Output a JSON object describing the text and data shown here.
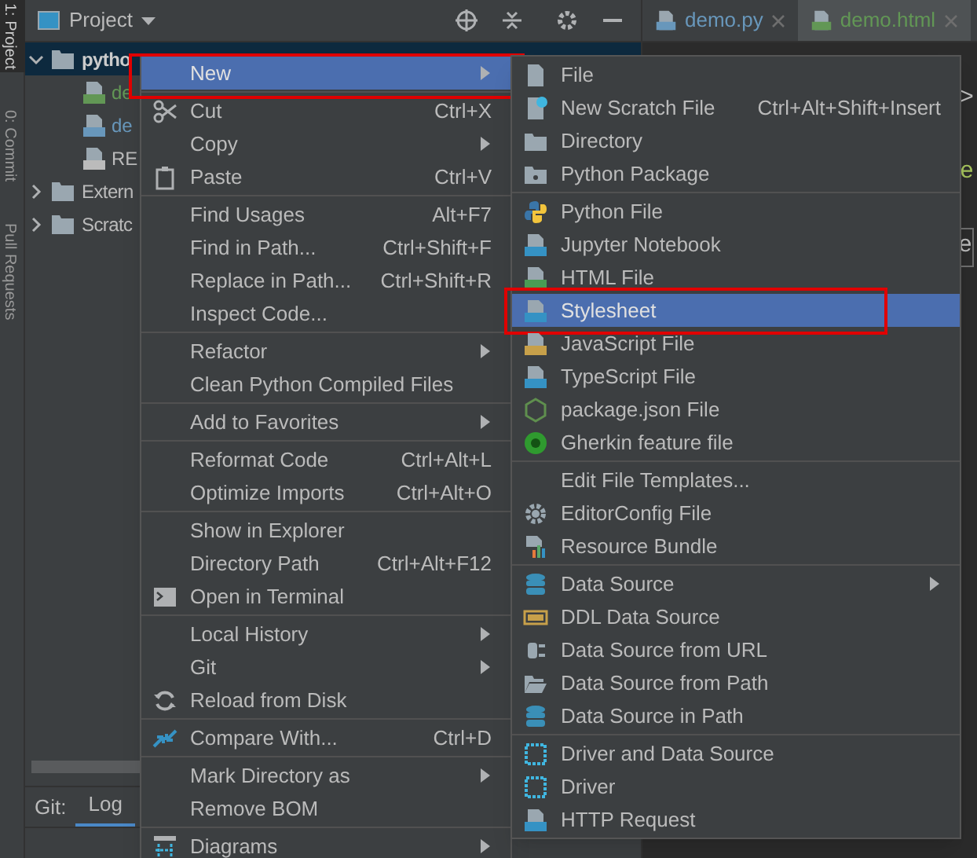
{
  "tool_strip": [
    {
      "label": "1: Project",
      "selected": true
    },
    {
      "label": "0: Commit",
      "selected": false
    },
    {
      "label": "Pull Requests",
      "selected": false
    }
  ],
  "project_panel": {
    "title": "Project",
    "tree": [
      {
        "label": "pytho",
        "selected": true,
        "expanded": true,
        "children": [
          {
            "label": "de",
            "color": "#629755"
          },
          {
            "label": "de",
            "color": "#6897bb"
          },
          {
            "label": "RE",
            "color": "#bbbbbb"
          }
        ]
      },
      {
        "label": "Extern",
        "selected": false,
        "expanded": false
      },
      {
        "label": "Scratc",
        "selected": false,
        "expanded": false
      }
    ]
  },
  "editor_tabs": [
    {
      "label": "demo.py",
      "selected": false,
      "color": "#6897bb"
    },
    {
      "label": "demo.html",
      "selected": true,
      "color": "#629755"
    }
  ],
  "editor_fragments": [
    ">",
    "e",
    "e"
  ],
  "bottom_panel": {
    "label": "Git:",
    "tabs": [
      {
        "label": "Log",
        "selected": true
      }
    ]
  },
  "context_menu": {
    "groups": [
      [
        {
          "label": "New",
          "submenu": true,
          "selected": true,
          "annotated": true
        }
      ],
      [
        {
          "label": "Cut",
          "shortcut": "Ctrl+X",
          "selected": false
        },
        {
          "label": "Copy",
          "submenu": true,
          "selected": false
        },
        {
          "label": "Paste",
          "shortcut": "Ctrl+V",
          "selected": false
        }
      ],
      [
        {
          "label": "Find Usages",
          "shortcut": "Alt+F7",
          "selected": false
        },
        {
          "label": "Find in Path...",
          "shortcut": "Ctrl+Shift+F",
          "selected": false
        },
        {
          "label": "Replace in Path...",
          "shortcut": "Ctrl+Shift+R",
          "selected": false
        },
        {
          "label": "Inspect Code...",
          "selected": false
        }
      ],
      [
        {
          "label": "Refactor",
          "submenu": true,
          "selected": false
        },
        {
          "label": "Clean Python Compiled Files",
          "selected": false
        }
      ],
      [
        {
          "label": "Add to Favorites",
          "submenu": true,
          "selected": false
        }
      ],
      [
        {
          "label": "Reformat Code",
          "shortcut": "Ctrl+Alt+L",
          "selected": false
        },
        {
          "label": "Optimize Imports",
          "shortcut": "Ctrl+Alt+O",
          "selected": false
        }
      ],
      [
        {
          "label": "Show in Explorer",
          "selected": false
        },
        {
          "label": "Directory Path",
          "shortcut": "Ctrl+Alt+F12",
          "selected": false
        },
        {
          "label": "Open in Terminal",
          "selected": false
        }
      ],
      [
        {
          "label": "Local History",
          "submenu": true,
          "selected": false
        },
        {
          "label": "Git",
          "submenu": true,
          "selected": false
        },
        {
          "label": "Reload from Disk",
          "selected": false
        }
      ],
      [
        {
          "label": "Compare With...",
          "shortcut": "Ctrl+D",
          "selected": false
        }
      ],
      [
        {
          "label": "Mark Directory as",
          "submenu": true,
          "selected": false
        },
        {
          "label": "Remove BOM",
          "selected": false
        }
      ],
      [
        {
          "label": "Diagrams",
          "submenu": true,
          "selected": false
        }
      ]
    ]
  },
  "new_submenu": {
    "groups": [
      [
        {
          "label": "File",
          "selected": false
        },
        {
          "label": "New Scratch File",
          "shortcut": "Ctrl+Alt+Shift+Insert",
          "selected": false
        },
        {
          "label": "Directory",
          "selected": false
        },
        {
          "label": "Python Package",
          "selected": false
        }
      ],
      [
        {
          "label": "Python File",
          "selected": false
        },
        {
          "label": "Jupyter Notebook",
          "selected": false
        },
        {
          "label": "HTML File",
          "selected": false
        },
        {
          "label": "Stylesheet",
          "selected": true,
          "annotated": true
        },
        {
          "label": "JavaScript File",
          "selected": false
        },
        {
          "label": "TypeScript File",
          "selected": false
        },
        {
          "label": "package.json File",
          "selected": false
        },
        {
          "label": "Gherkin feature file",
          "selected": false
        }
      ],
      [
        {
          "label": "Edit File Templates...",
          "selected": false
        },
        {
          "label": "EditorConfig File",
          "selected": false
        },
        {
          "label": "Resource Bundle",
          "selected": false
        }
      ],
      [
        {
          "label": "Data Source",
          "submenu": true,
          "selected": false
        },
        {
          "label": "DDL Data Source",
          "selected": false
        },
        {
          "label": "Data Source from URL",
          "selected": false
        },
        {
          "label": "Data Source from Path",
          "selected": false
        },
        {
          "label": "Data Source in Path",
          "selected": false
        }
      ],
      [
        {
          "label": "Driver and Data Source",
          "selected": false
        },
        {
          "label": "Driver",
          "selected": false
        },
        {
          "label": "HTTP Request",
          "selected": false
        }
      ]
    ]
  }
}
